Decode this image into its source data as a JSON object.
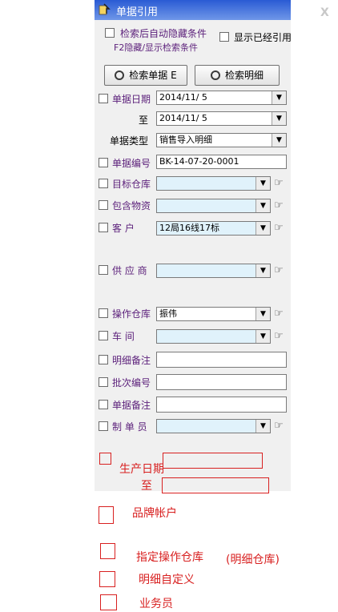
{
  "window": {
    "title": "单据引用",
    "close_glyph": "X"
  },
  "options": {
    "auto_hide_label": "检索后自动隐藏条件",
    "f2_hint": "F2隐藏/显示检索条件",
    "show_cited_label": "显示已经引用"
  },
  "buttons": {
    "search_doc": "检索单据 E",
    "search_detail": "检索明细"
  },
  "fields": {
    "doc_date": {
      "label": "单据日期",
      "value": "2014/11/  5"
    },
    "to_date": {
      "label": "至",
      "value": "2014/11/  5"
    },
    "doc_type": {
      "label": "单据类型",
      "value": "销售导入明细"
    },
    "doc_no": {
      "label": "单据编号",
      "value": "BK-14-07-20-0001"
    },
    "target_wh": {
      "label": "目标仓库",
      "value": ""
    },
    "material": {
      "label": "包含物资",
      "value": ""
    },
    "customer": {
      "label": "客    户",
      "value": "12局16线17标"
    },
    "supplier": {
      "label": "供 应 商",
      "value": ""
    },
    "op_wh": {
      "label": "操作仓库",
      "value": "振伟"
    },
    "workshop": {
      "label": "车    间",
      "value": ""
    },
    "detail_note": {
      "label": "明细备注",
      "value": ""
    },
    "batch_no": {
      "label": "批次编号",
      "value": ""
    },
    "doc_note": {
      "label": "单据备注",
      "value": ""
    },
    "maker": {
      "label": "制 单 员",
      "value": ""
    }
  },
  "annotations": {
    "prod_date": "生产日期",
    "to": "至",
    "brand_account": "品牌帐户",
    "designated_wh": "指定操作仓库",
    "detail_wh": "(明细仓库)",
    "detail_custom": "明细自定义",
    "salesman": "业务员"
  },
  "colors": {
    "title_bar": "#2a5bd4",
    "field_blue": "#e0f2fb",
    "annotation_red": "#d82020",
    "label_purple": "#5b1f7a"
  }
}
